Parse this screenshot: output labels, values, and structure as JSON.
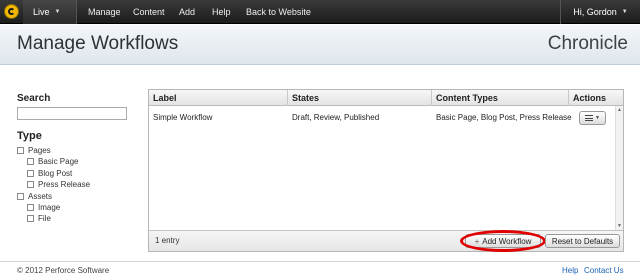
{
  "topbar": {
    "live_label": "Live",
    "nav": [
      "Manage",
      "Content",
      "Add",
      "Help",
      "Back to Website"
    ],
    "user_label": "Hi, Gordon"
  },
  "header": {
    "title": "Manage Workflows",
    "brand": "Chronicle"
  },
  "sidebar": {
    "search_label": "Search",
    "search_value": "",
    "type_label": "Type",
    "filters": {
      "pages": "Pages",
      "basic_page": "Basic Page",
      "blog_post": "Blog Post",
      "press_release": "Press Release",
      "assets": "Assets",
      "image": "Image",
      "file": "File"
    }
  },
  "grid": {
    "columns": [
      "Label",
      "States",
      "Content Types",
      "Actions"
    ],
    "rows": [
      {
        "label": "Simple Workflow",
        "states": "Draft, Review, Published",
        "content_types": "Basic Page, Blog Post, Press Release"
      }
    ],
    "entry_count": "1 entry",
    "add_label": "Add Workflow",
    "reset_label": "Reset to Defaults"
  },
  "footer": {
    "copyright": "© 2012 Perforce Software",
    "help": "Help",
    "contact": "Contact Us"
  },
  "colors": {
    "highlight": "#e10000",
    "link": "#1b62b0",
    "logo": "#f2b705"
  }
}
